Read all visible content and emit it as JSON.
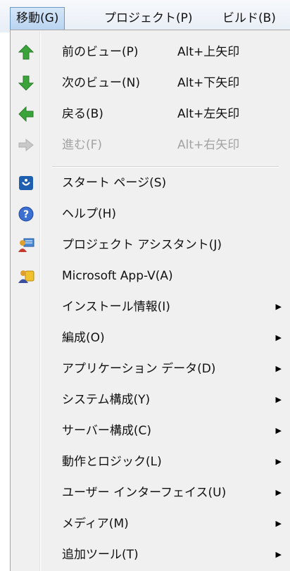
{
  "menubar": {
    "items": [
      {
        "label": "移動(G)",
        "active": true
      },
      {
        "label": "プロジェクト(P)"
      },
      {
        "label": "ビルド(B)"
      }
    ]
  },
  "menu": {
    "items": [
      {
        "label": "前のビュー(P)",
        "shortcut": "Alt+上矢印",
        "icon": "up-arrow-icon"
      },
      {
        "label": "次のビュー(N)",
        "shortcut": "Alt+下矢印",
        "icon": "down-arrow-icon"
      },
      {
        "label": "戻る(B)",
        "shortcut": "Alt+左矢印",
        "icon": "back-arrow-icon"
      },
      {
        "label": "進む(F)",
        "shortcut": "Alt+右矢印",
        "icon": "forward-arrow-icon",
        "disabled": true
      },
      {
        "label": "スタート ページ(S)",
        "icon": "start-page-icon"
      },
      {
        "label": "ヘルプ(H)",
        "icon": "help-icon"
      },
      {
        "label": "プロジェクト アシスタント(J)",
        "icon": "project-assistant-icon"
      },
      {
        "label": "Microsoft App-V(A)",
        "icon": "app-v-icon"
      },
      {
        "label": "インストール情報(I)",
        "submenu": true
      },
      {
        "label": "編成(O)",
        "submenu": true
      },
      {
        "label": "アプリケーション データ(D)",
        "submenu": true
      },
      {
        "label": "システム構成(Y)",
        "submenu": true
      },
      {
        "label": "サーバー構成(C)",
        "submenu": true
      },
      {
        "label": "動作とロジック(L)",
        "submenu": true
      },
      {
        "label": "ユーザー インターフェイス(U)",
        "submenu": true
      },
      {
        "label": "メディア(M)",
        "submenu": true
      },
      {
        "label": "追加ツール(T)",
        "submenu": true
      }
    ]
  },
  "colors": {
    "arrow_green": "#3aa43a",
    "disabled_gray": "#a3a3a3",
    "menu_bg": "#f0f0f0",
    "highlight_blue": "#b9d4f1"
  }
}
